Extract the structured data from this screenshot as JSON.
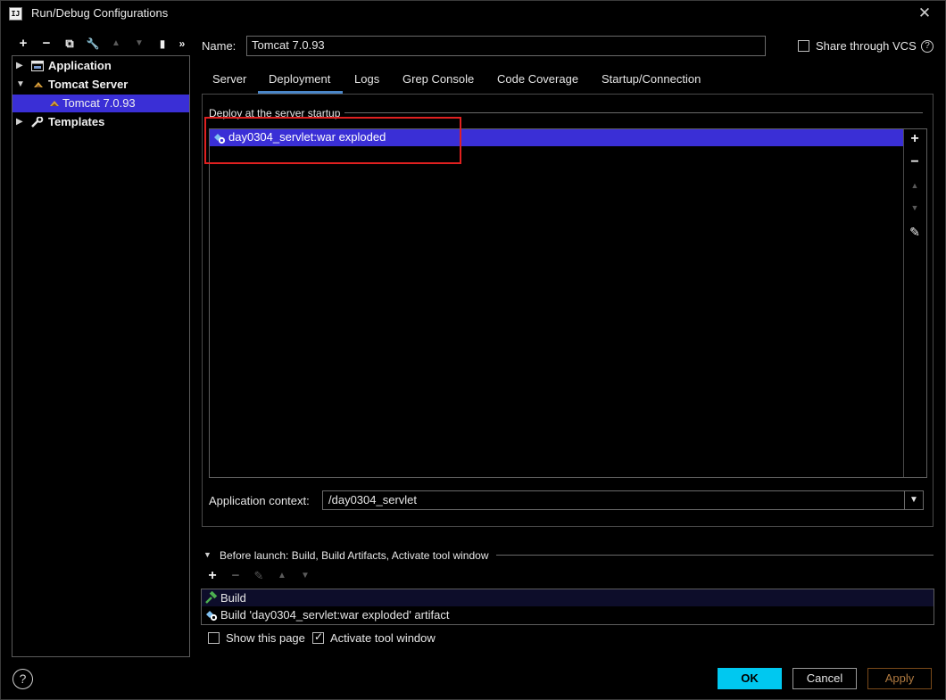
{
  "window": {
    "title": "Run/Debug Configurations",
    "logo_text": "IJ"
  },
  "toolbar": {
    "add": "+",
    "remove": "−",
    "copy": "⧉",
    "edit": "🔧",
    "up": "▲",
    "down": "▼",
    "folder": "▮",
    "more": "»"
  },
  "tree": {
    "items": [
      {
        "label": "Application",
        "icon": "application-icon"
      },
      {
        "label": "Tomcat Server",
        "icon": "tomcat-icon"
      },
      {
        "label": "Tomcat 7.0.93",
        "icon": "tomcat-icon"
      },
      {
        "label": "Templates",
        "icon": "wrench-icon"
      }
    ]
  },
  "name_field": {
    "label": "Name:",
    "value": "Tomcat 7.0.93"
  },
  "share_vcs": {
    "label": "Share through VCS",
    "checked": false,
    "help": "?"
  },
  "tabs": [
    "Server",
    "Deployment",
    "Logs",
    "Grep Console",
    "Code Coverage",
    "Startup/Connection"
  ],
  "active_tab": "Deployment",
  "deployment": {
    "section_title": "Deploy at the server startup",
    "artifacts": [
      "day0304_servlet:war exploded"
    ],
    "side_buttons": {
      "add": "+",
      "remove": "−",
      "up": "▲",
      "down": "▼",
      "edit": "✎"
    }
  },
  "app_context": {
    "label": "Application context:",
    "value": "/day0304_servlet",
    "dropdown": "▼"
  },
  "before_launch": {
    "toggle": "▼",
    "title": "Before launch: Build, Build Artifacts, Activate tool window",
    "toolbar": {
      "add": "+",
      "remove": "−",
      "edit": "✎",
      "up": "▲",
      "down": "▼"
    },
    "items": [
      "Build",
      "Build 'day0304_servlet:war exploded' artifact"
    ]
  },
  "options": {
    "show_page": {
      "label": "Show this page",
      "checked": false
    },
    "activate_tool_window": {
      "label": "Activate tool window",
      "checked": true
    }
  },
  "buttons": {
    "help": "?",
    "ok": "OK",
    "cancel": "Cancel",
    "apply": "Apply"
  },
  "colors": {
    "selection": "#3a2fd6",
    "ok_button": "#00c8f0",
    "highlight_box": "#e02020",
    "tab_underline": "#4a86c8"
  }
}
